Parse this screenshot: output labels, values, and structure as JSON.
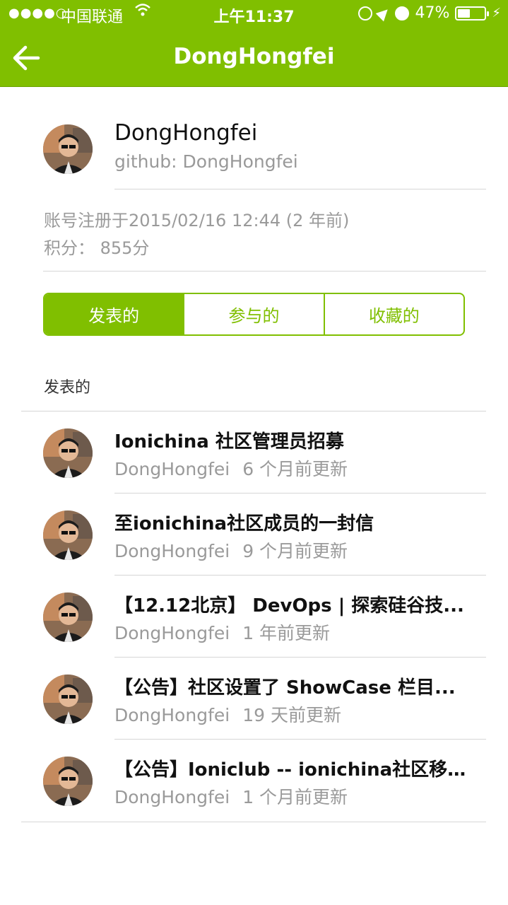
{
  "status_bar": {
    "signal": "●●●●○",
    "carrier": "中国联通",
    "time": "上午11:37",
    "battery": "47%",
    "battery_level": 0.47
  },
  "nav": {
    "title": "DongHongfei",
    "back_icon": "arrow-left-icon"
  },
  "profile": {
    "name": "DongHongfei",
    "github": "github: DongHongfei",
    "registered": "账号注册于2015/02/16 12:44 (2 年前)",
    "score": "积分： 855分"
  },
  "tabs": [
    {
      "label": "发表的",
      "active": true
    },
    {
      "label": "参与的",
      "active": false
    },
    {
      "label": "收藏的",
      "active": false
    }
  ],
  "section_title": "发表的",
  "topics": [
    {
      "title": "Ionichina 社区管理员招募",
      "author": "DongHongfei",
      "time": "6 个月前更新"
    },
    {
      "title": "至ionichina社区成员的一封信",
      "author": "DongHongfei",
      "time": "9 个月前更新"
    },
    {
      "title": "【12.12北京】 DevOps | 探索硅谷技...",
      "author": "DongHongfei",
      "time": "1 年前更新"
    },
    {
      "title": "【公告】社区设置了 ShowCase 栏目...",
      "author": "DongHongfei",
      "time": "19 天前更新"
    },
    {
      "title": "【公告】Ioniclub -- ionichina社区移...",
      "author": "DongHongfei",
      "time": "1 个月前更新"
    }
  ],
  "colors": {
    "accent": "#80bf00",
    "text_muted": "#9a9a9a"
  }
}
